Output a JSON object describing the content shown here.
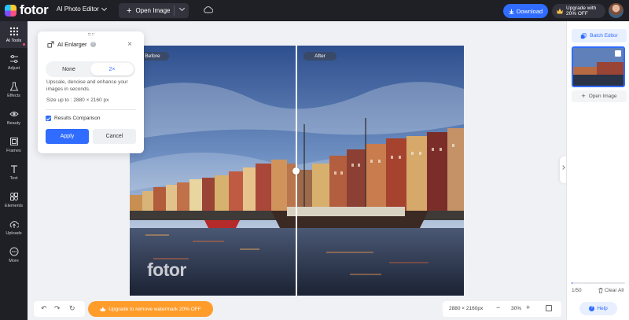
{
  "header": {
    "logo_text": "fotor",
    "editor_mode": "AI Photo Editor",
    "open_image": "Open Image",
    "download": "Download",
    "upgrade_line1": "Upgrade with",
    "upgrade_line2": "20% OFF"
  },
  "sidebar": {
    "items": [
      {
        "label": "AI Tools",
        "icon": "grid-icon"
      },
      {
        "label": "Adjust",
        "icon": "sliders-icon"
      },
      {
        "label": "Effects",
        "icon": "flask-icon"
      },
      {
        "label": "Beauty",
        "icon": "eye-icon"
      },
      {
        "label": "Frames",
        "icon": "frame-icon"
      },
      {
        "label": "Text",
        "icon": "text-icon"
      },
      {
        "label": "Elements",
        "icon": "shapes-icon"
      },
      {
        "label": "Uploads",
        "icon": "cloud-upload-icon"
      },
      {
        "label": "More",
        "icon": "more-icon"
      }
    ]
  },
  "panel": {
    "title": "AI Enlarger",
    "options": [
      "None",
      "2×"
    ],
    "selected": "2×",
    "description": "Upscale, denoise and enhance your images in seconds.",
    "size_text": "Size up to : 2880 × 2160 px",
    "comparison_label": "Results Comparison",
    "comparison_checked": true,
    "apply": "Apply",
    "cancel": "Cancel"
  },
  "canvas": {
    "before_label": "Before",
    "after_label": "After",
    "watermark": "fotor"
  },
  "right_panel": {
    "batch_editor": "Batch Editor",
    "open_image": "Open Image",
    "count": "1/50",
    "clear_all": "Clear All",
    "help": "Help"
  },
  "bottom": {
    "watermark_banner": "Upgrade to remove watermark 20% OFF",
    "dimensions": "2880 × 2160px",
    "zoom": "30%",
    "minus": "−",
    "plus": "+"
  },
  "colors": {
    "accent": "#2f6cff",
    "dark_chrome": "#1f1f26",
    "promo": "#ff9c2a"
  }
}
